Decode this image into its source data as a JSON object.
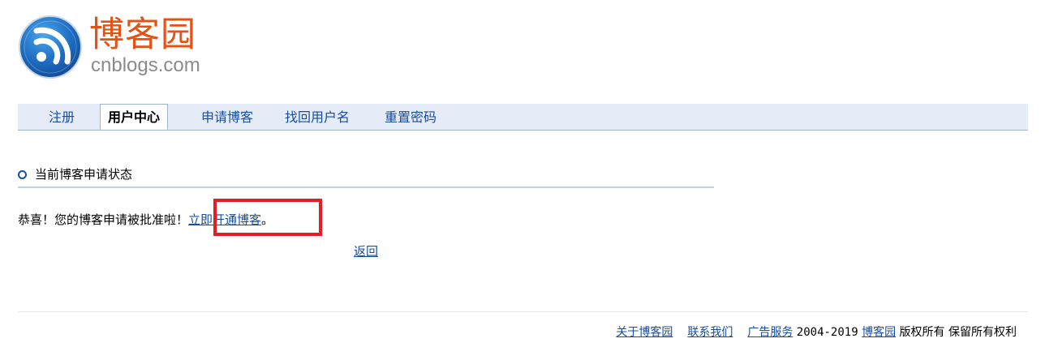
{
  "logo": {
    "name_cn": "博客园",
    "domain": "cnblogs.com",
    "brand_color": "#e35315"
  },
  "nav": {
    "items": [
      {
        "label": "注册",
        "active": false
      },
      {
        "label": "用户中心",
        "active": true
      },
      {
        "label": "申请博客",
        "active": false
      },
      {
        "label": "找回用户名",
        "active": false
      },
      {
        "label": "重置密码",
        "active": false
      }
    ]
  },
  "section": {
    "title": "当前博客申请状态"
  },
  "message": {
    "text": "恭喜！您的博客申请被批准啦！",
    "link_label": "立即开通博客",
    "suffix": "。"
  },
  "back_label": "返回",
  "footer": {
    "about": "关于博客园",
    "contact": "联系我们",
    "ads": "广告服务",
    "years": "2004-2019",
    "brand": "博客园",
    "rights": "版权所有 保留所有权利"
  },
  "colors": {
    "link": "#174ea0",
    "nav_bg": "#e5ecf7",
    "highlight": "#e31e24"
  }
}
